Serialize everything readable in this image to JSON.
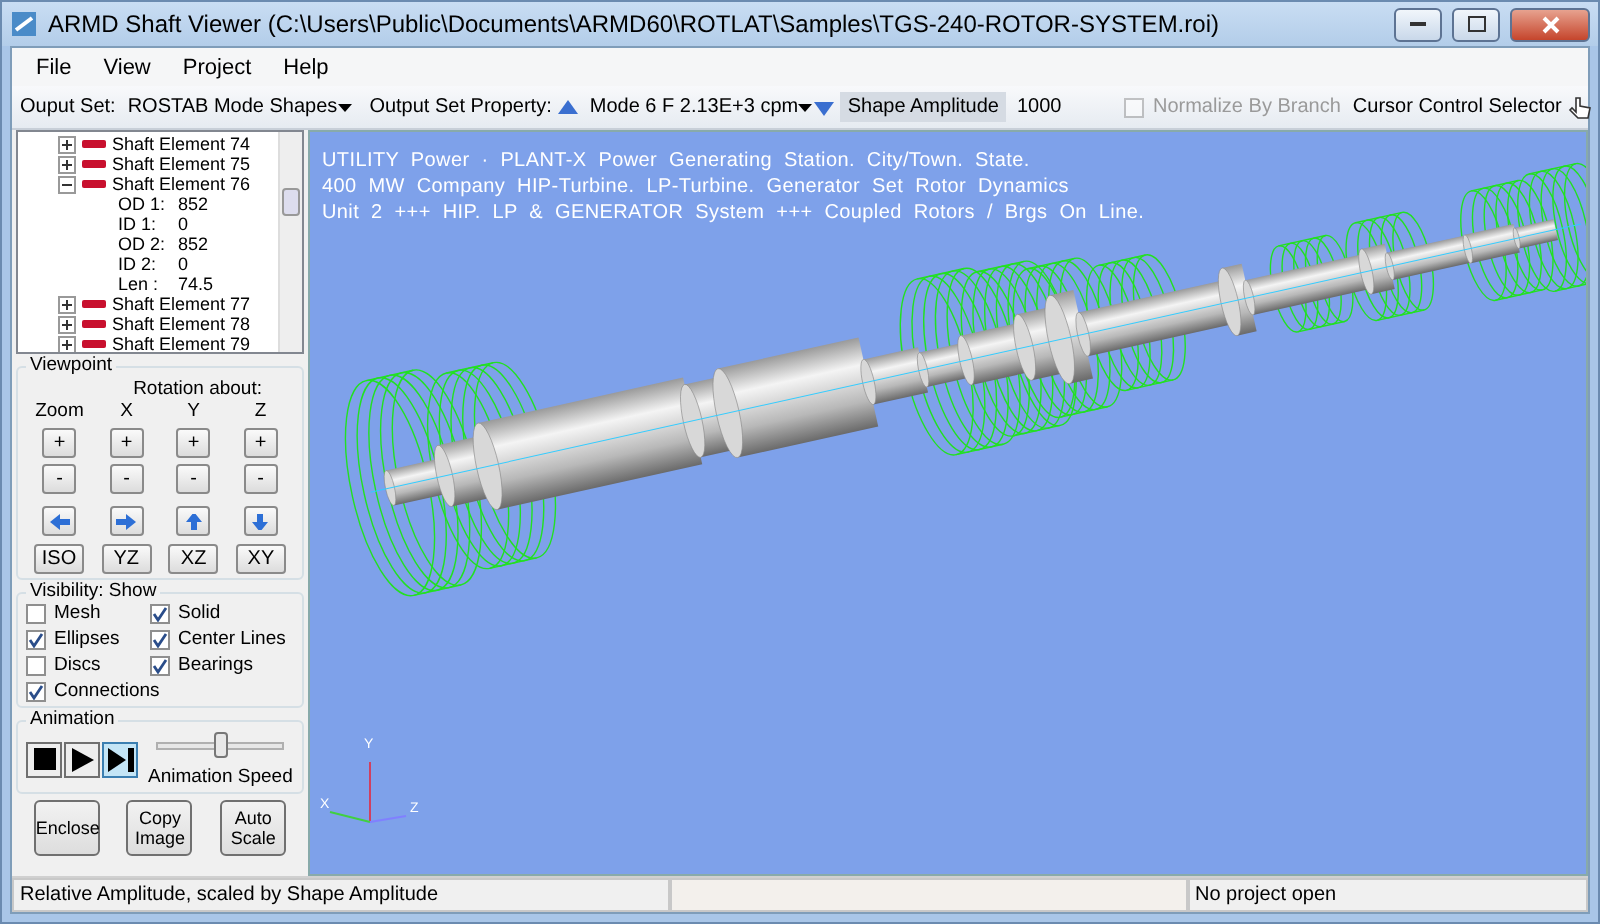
{
  "window": {
    "title": "ARMD Shaft Viewer (C:\\Users\\Public\\Documents\\ARMD60\\ROTLAT\\Samples\\TGS-240-ROTOR-SYSTEM.roi)"
  },
  "menu": [
    "File",
    "View",
    "Project",
    "Help"
  ],
  "toolbar": {
    "output_set_label": "Ouput Set:",
    "output_set": "ROSTAB Mode Shapes",
    "property_label": "Output Set Property:",
    "property": "Mode 6 F 2.13E+3 cpm",
    "amplitude_label": "Shape Amplitude",
    "amplitude": "1000",
    "normalize": {
      "label": "Normalize By Branch",
      "checked": false,
      "disabled": true
    },
    "cursor_label": "Cursor Control Selector"
  },
  "tree": [
    {
      "label": "Shaft Element 74",
      "expanded": false
    },
    {
      "label": "Shaft Element 75",
      "expanded": false
    },
    {
      "label": "Shaft Element 76",
      "expanded": true,
      "children": [
        {
          "label": "OD 1:",
          "value": "852"
        },
        {
          "label": "ID  1:",
          "value": "0"
        },
        {
          "label": "OD 2:",
          "value": "852"
        },
        {
          "label": "ID  2:",
          "value": "0"
        },
        {
          "label": "Len  :",
          "value": "74.5"
        }
      ]
    },
    {
      "label": "Shaft Element 77",
      "expanded": false
    },
    {
      "label": "Shaft Element 78",
      "expanded": false
    },
    {
      "label": "Shaft Element 79",
      "expanded": false
    }
  ],
  "viewpoint": {
    "title": "Viewpoint",
    "rotation_label": "Rotation about:",
    "columns": [
      {
        "header": "Zoom",
        "plus": "+",
        "minus": "-"
      },
      {
        "header": "X",
        "plus": "+",
        "minus": "-"
      },
      {
        "header": "Y",
        "plus": "+",
        "minus": "-"
      },
      {
        "header": "Z",
        "plus": "+",
        "minus": "-"
      }
    ],
    "views": [
      "ISO",
      "YZ",
      "XZ",
      "XY"
    ]
  },
  "visibility": {
    "title": "Visibility: Show",
    "options": [
      {
        "label": "Mesh",
        "checked": false
      },
      {
        "label": "Solid",
        "checked": true
      },
      {
        "label": "Ellipses",
        "checked": true
      },
      {
        "label": "Center Lines",
        "checked": true
      },
      {
        "label": "Discs",
        "checked": false
      },
      {
        "label": "Bearings",
        "checked": true
      },
      {
        "label": "Connections",
        "checked": true
      }
    ]
  },
  "animation": {
    "title": "Animation",
    "controls": [
      {
        "kind": "stop",
        "selected": false
      },
      {
        "kind": "play",
        "selected": false
      },
      {
        "kind": "step",
        "selected": true
      }
    ],
    "speed": {
      "label": "Animation Speed",
      "level": 0.5
    }
  },
  "actions": [
    "Enclose",
    "Copy Image",
    "Auto Scale"
  ],
  "viewport": {
    "caption": [
      "UTILITY  Power  ·  PLANT-X  Power  Generating  Station.  City/Town.  State.",
      "400  MW  Company  HIP-Turbine.  LP-Turbine.  Generator  Set  Rotor  Dynamics",
      "Unit  2  +++  HIP.  LP  &  GENERATOR  System  +++  Coupled  Rotors  /  Brgs  On  Line."
    ],
    "axes": [
      "Y",
      "X",
      "Z"
    ]
  },
  "status_bar": {
    "message": "Relative Amplitude, scaled by Shape Amplitude",
    "project": "No project open"
  }
}
